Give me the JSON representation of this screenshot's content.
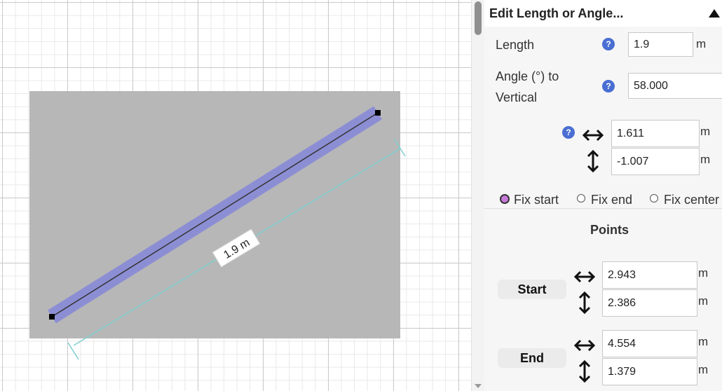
{
  "canvas": {
    "dimension_label": "1.9 m",
    "colors": {
      "background_rect": "#b7b7b7",
      "line_highlight": "#8a8cd6",
      "line_stroke": "#333333",
      "dimension_line": "#7fcfcf",
      "endpoint": "#000000"
    }
  },
  "panel": {
    "title": "Edit Length or Angle...",
    "collapse_icon": "triangle-up-icon",
    "help_icon_label": "?",
    "length": {
      "label": "Length",
      "value": "1.9",
      "unit": "m"
    },
    "angle": {
      "label_line1": "Angle (°) to",
      "label_line2": "Vertical",
      "value": "58.000"
    },
    "delta": {
      "horizontal": {
        "value": "1.611",
        "unit": "m",
        "icon": "horizontal-arrows-icon"
      },
      "vertical": {
        "value": "-1.007",
        "unit": "m",
        "icon": "vertical-arrows-icon"
      }
    },
    "fix_options": [
      {
        "label": "Fix start",
        "checked": true
      },
      {
        "label": "Fix end",
        "checked": false
      },
      {
        "label": "Fix center",
        "checked": false
      }
    ],
    "points": {
      "title": "Points",
      "start": {
        "label": "Start",
        "x": "2.943",
        "y": "2.386",
        "unit": "m"
      },
      "end": {
        "label": "End",
        "x": "4.554",
        "y": "1.379",
        "unit": "m"
      }
    }
  }
}
